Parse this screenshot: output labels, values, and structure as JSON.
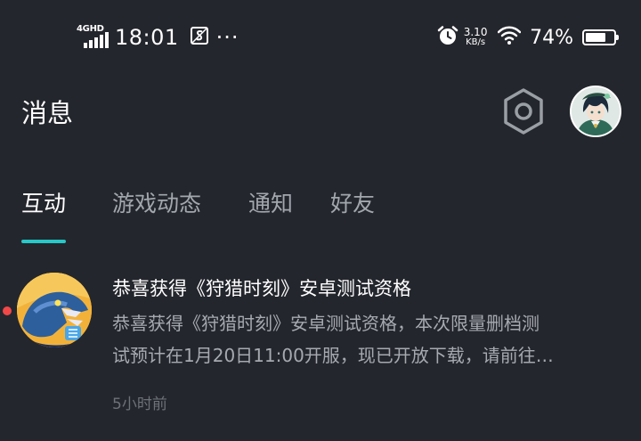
{
  "status_bar": {
    "network_type": "4GHD",
    "time": "18:01",
    "more_indicator": "···",
    "net_speed_value": "3.10",
    "net_speed_unit": "KB/s",
    "battery_percent": "74%",
    "battery_level": 0.74,
    "icons": [
      "signal-icon",
      "sim-icon",
      "alarm-icon",
      "wifi-icon",
      "battery-icon"
    ]
  },
  "header": {
    "title": "消息",
    "settings_icon": "gear-icon",
    "avatar": "user-avatar"
  },
  "tabs": [
    {
      "label": "互动",
      "active": true
    },
    {
      "label": "游戏动态",
      "active": false
    },
    {
      "label": "通知",
      "active": false
    },
    {
      "label": "好友",
      "active": false
    }
  ],
  "accent_color": "#27c8c8",
  "messages": [
    {
      "title": "恭喜获得《狩猎时刻》安卓测试资格",
      "body_line1": "恭喜获得《狩猎时刻》安卓测试资格，本次限量删档测",
      "body_line2": "试预计在1月20日11:00开服，现已开放下载，请前往…",
      "time": "5小时前",
      "unread": true,
      "unread_color": "#f04848"
    }
  ]
}
